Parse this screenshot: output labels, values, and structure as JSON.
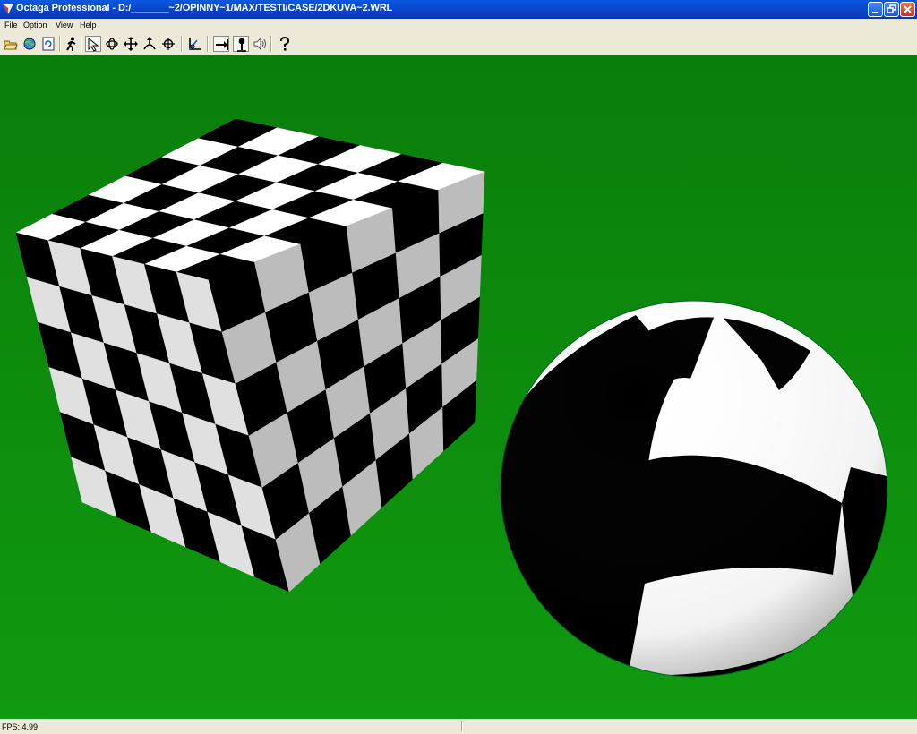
{
  "window": {
    "title": "Octaga Professional - D:/_______~2/OPINNY~1/MAX/TESTI/CASE/2DKUVA~2.WRL"
  },
  "menu": [
    "File",
    "Option",
    "View",
    "Help"
  ],
  "toolbar": [
    {
      "name": "open-icon"
    },
    {
      "name": "open-url-icon"
    },
    {
      "name": "reload-icon"
    },
    {
      "name": "walk-icon"
    },
    {
      "name": "pointer-icon",
      "pressed": true
    },
    {
      "name": "examine-icon"
    },
    {
      "name": "pan-icon"
    },
    {
      "name": "tilt-icon"
    },
    {
      "name": "target-icon"
    },
    {
      "name": "straighten-icon"
    },
    {
      "name": "collision-icon",
      "pressed": true
    },
    {
      "name": "gravity-icon",
      "pressed": true
    },
    {
      "name": "sound-icon"
    },
    {
      "name": "help-icon"
    }
  ],
  "status": {
    "fps": "FPS: 4.99"
  },
  "colors": {
    "titlebar": "#0a58e0",
    "viewport": "#0c8c0c",
    "checker_dark": "#000000",
    "checker_light": "#ffffff"
  }
}
